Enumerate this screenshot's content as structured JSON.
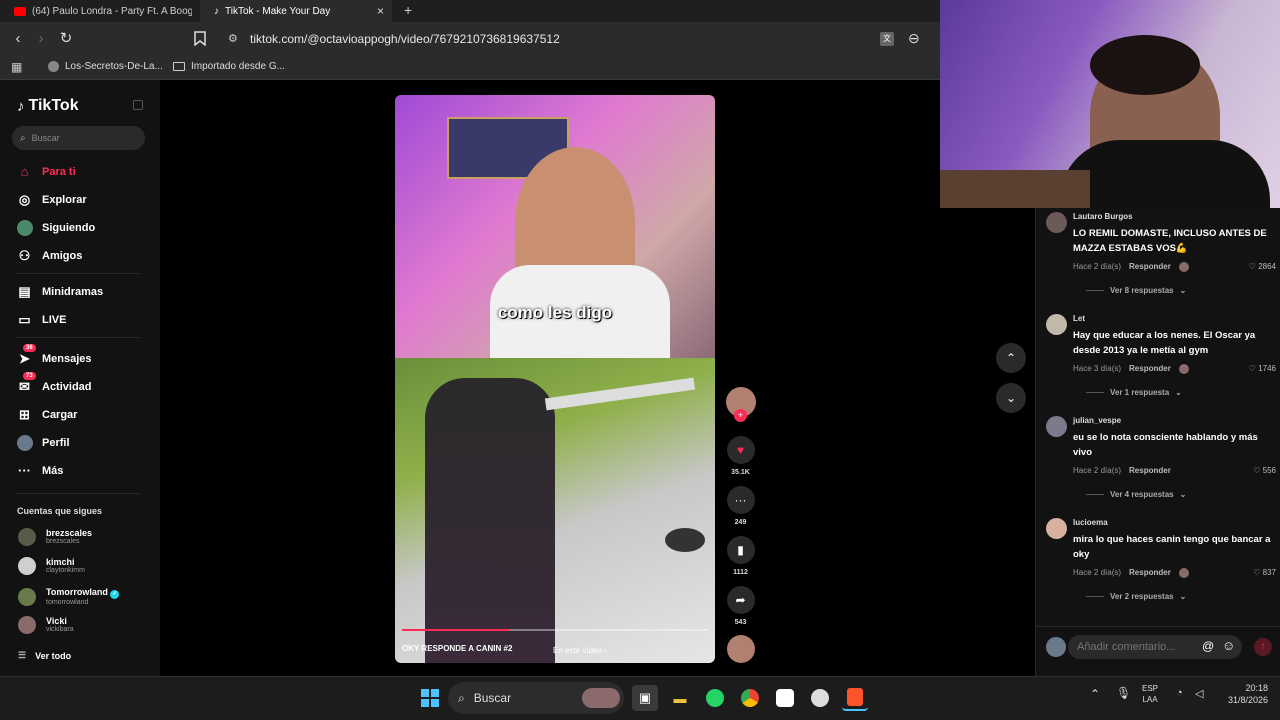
{
  "browser": {
    "tabs": [
      {
        "label": "(64) Paulo Londra - Party Ft. A Boogie",
        "icon": "youtube-icon"
      },
      {
        "label": "TikTok - Make Your Day",
        "icon": "tiktok-icon"
      }
    ],
    "new_tab": "+",
    "close": "×",
    "url": "tiktok.com/@octavioappogh/video/7679210736819637512",
    "bookmarks": [
      {
        "label": "Los-Secretos-De-La..."
      },
      {
        "label": "Importado desde G..."
      }
    ]
  },
  "sidebar": {
    "logo": "TikTok",
    "search_placeholder": "Buscar",
    "nav": [
      {
        "label": "Para ti",
        "icon": "home-icon",
        "active": true
      },
      {
        "label": "Explorar",
        "icon": "compass-icon"
      },
      {
        "label": "Siguiendo",
        "icon": "following-icon"
      },
      {
        "label": "Amigos",
        "icon": "friends-icon"
      },
      {
        "label": "Minidramas",
        "icon": "film-icon"
      },
      {
        "label": "LIVE",
        "icon": "live-icon"
      },
      {
        "label": "Mensajes",
        "icon": "message-icon",
        "badge": "36"
      },
      {
        "label": "Actividad",
        "icon": "activity-icon",
        "badge": "73"
      },
      {
        "label": "Cargar",
        "icon": "upload-icon"
      },
      {
        "label": "Perfil",
        "icon": "profile-icon"
      },
      {
        "label": "Más",
        "icon": "more-icon"
      }
    ],
    "following_title": "Cuentas que sigues",
    "following": [
      {
        "name": "brezscales",
        "handle": "brezscales"
      },
      {
        "name": "kimchi",
        "handle": "claytonkimm"
      },
      {
        "name": "Tomorrowland",
        "handle": "tomorrowland",
        "verified": true
      },
      {
        "name": "Vicki",
        "handle": "vickibara"
      }
    ],
    "see_all": "Ver todo"
  },
  "video": {
    "caption": "como les digo",
    "title": "OKY RESPONDE A CANIN #2",
    "link": "En este vídeo",
    "progress": 0.35
  },
  "actions": {
    "likes": "35.1K",
    "comments": "249",
    "saves": "1112",
    "shares": "543"
  },
  "comments": [
    {
      "user": "Lautaro Burgos",
      "text": "LO REMIL DOMASTE, INCLUSO ANTES DE MAZZA ESTABAS VOS💪",
      "time": "Hace 2 día(s)",
      "reply": "Responder",
      "likes": "2864",
      "more": "Ver 8 respuestas"
    },
    {
      "user": "Let",
      "text": "Hay que educar a los nenes. El Oscar ya desde 2013 ya le metía al gym",
      "time": "Hace 3 día(s)",
      "reply": "Responder",
      "likes": "1746",
      "more": "Ver 1 respuesta"
    },
    {
      "user": "julian_vespe",
      "text": "eu se lo nota consciente hablando y más vivo",
      "time": "Hace 2 día(s)",
      "reply": "Responder",
      "likes": "556",
      "more": "Ver 4 respuestas"
    },
    {
      "user": "lucioema",
      "text": "mira lo que haces canin tengo que bancar a oky",
      "time": "Hace 2 día(s)",
      "reply": "Responder",
      "likes": "837",
      "more": "Ver 2 respuestas"
    }
  ],
  "comment_input": {
    "placeholder": "Añadir comentario..."
  },
  "taskbar": {
    "search": "Buscar",
    "lang_top": "ESP",
    "lang_bottom": "LAA",
    "time": "20:18",
    "date": "31/8/2026"
  },
  "colors": {
    "accent": "#fe2c55",
    "bg": "#121212"
  }
}
